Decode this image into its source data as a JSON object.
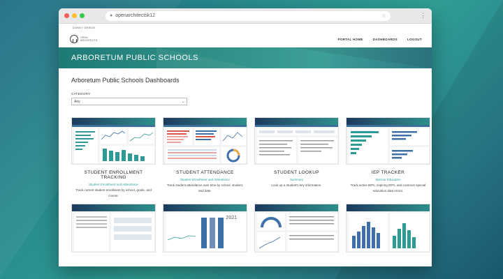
{
  "browser": {
    "url": "openarchitectsk12"
  },
  "debug_label": "DANNY DEBUG",
  "nav": {
    "logo_text": "OPEN ARCHITECTS",
    "links": [
      "PORTAL HOME",
      "DASHBOARDS",
      "LOGOUT"
    ]
  },
  "hero": {
    "title": "ARBORETUM PUBLIC SCHOOLS"
  },
  "main": {
    "section_title": "Arboretum Public Schools Dashboards",
    "category_label": "CATEGORY:",
    "category_value": "Any"
  },
  "cards": [
    {
      "title": "STUDENT ENROLLMENT TRACKING",
      "subtitle": "Student Enrollment and Attendance",
      "description": "Track current student enrollment by school, grade, and course."
    },
    {
      "title": "STUDENT ATTENDANCE",
      "subtitle": "Student Enrollment and Attendance",
      "description": "Track student attendance over time by school, student, and date."
    },
    {
      "title": "STUDENT LOOKUP",
      "subtitle": "Summary",
      "description": "Look up a student's key information."
    },
    {
      "title": "IEP TRACKER",
      "subtitle": "Special Education",
      "description": "Track active IEPs, expiring IEPs, and common special education data errors."
    }
  ],
  "row2_thumb_label": "2021",
  "colors": {
    "accent_teal": "#2aa39a",
    "hero_teal": "#2f8f86",
    "chart_teal": "#2f9a93",
    "chart_blue": "#3f6fa8",
    "chart_red": "#d9534f"
  },
  "icons": [
    "lock-icon",
    "star-icon",
    "kebab-menu-icon",
    "logo-icon",
    "chevron-down-icon"
  ]
}
